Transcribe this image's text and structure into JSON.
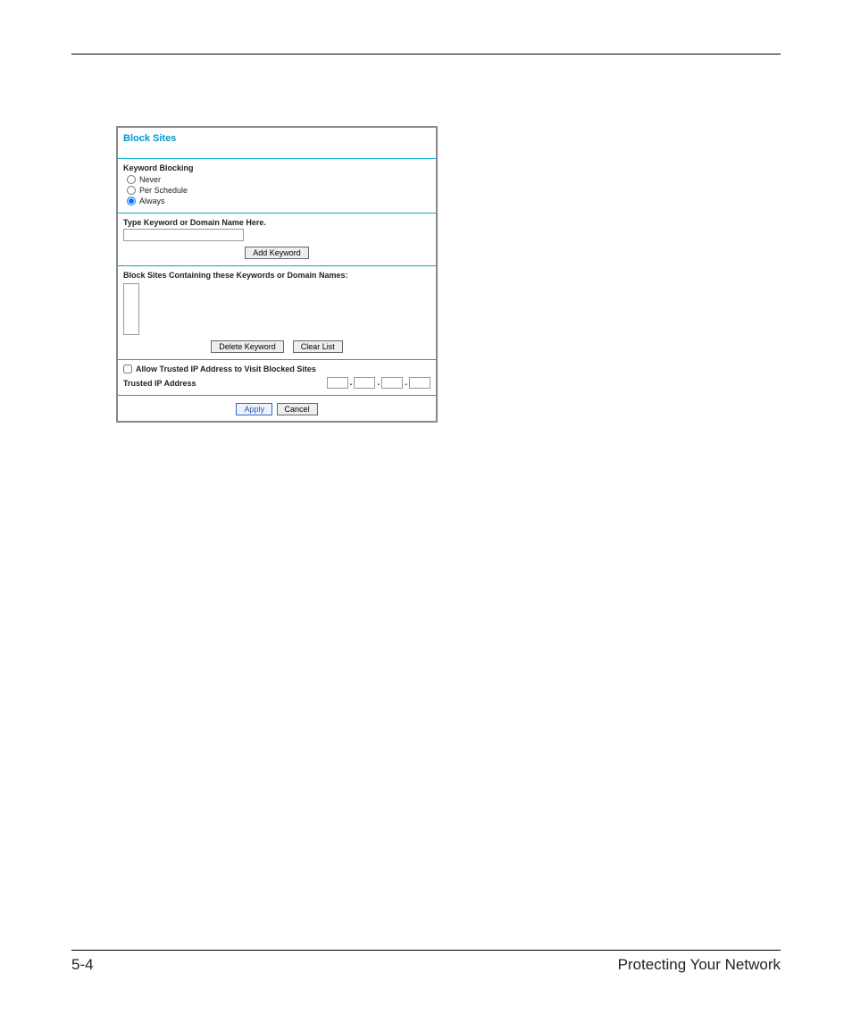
{
  "panel": {
    "title": "Block Sites",
    "keyword_blocking": {
      "heading": "Keyword Blocking",
      "options": {
        "never": "Never",
        "per_schedule": "Per Schedule",
        "always": "Always"
      },
      "selected": "always"
    },
    "type_keyword": {
      "heading": "Type Keyword or Domain Name Here.",
      "input_value": "",
      "add_button": "Add Keyword"
    },
    "block_list": {
      "heading": "Block Sites Containing these Keywords or Domain Names:",
      "delete_button": "Delete Keyword",
      "clear_button": "Clear List"
    },
    "trusted": {
      "checkbox_label": "Allow Trusted IP Address to Visit Blocked Sites",
      "ip_label": "Trusted IP Address",
      "octets": [
        "",
        "",
        "",
        ""
      ]
    },
    "actions": {
      "apply": "Apply",
      "cancel": "Cancel"
    }
  },
  "footer": {
    "page_number": "5-4",
    "chapter_title": "Protecting Your Network"
  }
}
